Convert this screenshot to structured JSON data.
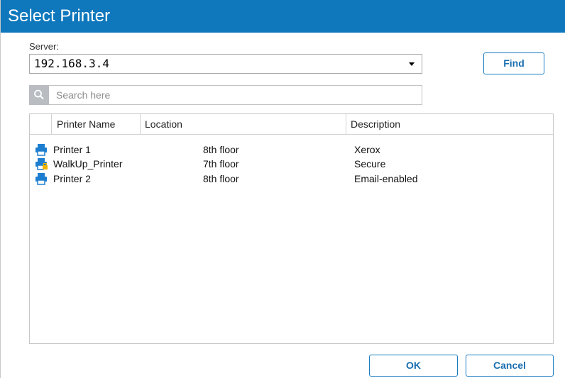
{
  "title": "Select Printer",
  "server": {
    "label": "Server:",
    "value": "192.168.3.4"
  },
  "find_button": "Find",
  "search": {
    "placeholder": "Search here"
  },
  "table": {
    "columns": [
      "",
      "Printer Name",
      "Location",
      "Description"
    ],
    "rows": [
      {
        "icon": "printer-icon",
        "name": "Printer 1",
        "location": "8th floor",
        "description": "Xerox"
      },
      {
        "icon": "secure-printer-icon",
        "name": "WalkUp_Printer",
        "location": "7th floor",
        "description": "Secure"
      },
      {
        "icon": "printer-icon",
        "name": "Printer 2",
        "location": "8th floor",
        "description": "Email-enabled"
      }
    ]
  },
  "footer": {
    "ok": "OK",
    "cancel": "Cancel"
  },
  "colors": {
    "title_bar": "#0f78bd",
    "accent": "#1a6fb0",
    "printer_icon": "#1d7ed0",
    "lock_badge": "#f0b400"
  }
}
